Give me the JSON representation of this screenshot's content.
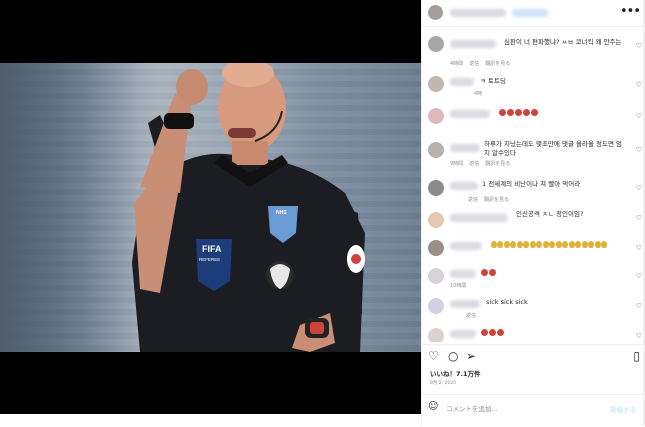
{
  "media": {
    "kit_badges": {
      "fifa": "FIFA",
      "referee": "REFEREE",
      "nhs": "NHS"
    }
  },
  "header": {
    "more_label": "•••"
  },
  "comments": [
    {
      "text": "심판이 너 편파했냐? ㅆㅂ 코너킥 왜 안주는",
      "meta": [
        "4時間",
        "返信",
        "翻訳を見る"
      ]
    },
    {
      "text": "ㅋ 토트딩",
      "meta": [
        "4時"
      ]
    },
    {
      "text": "",
      "badges": [
        "red",
        "red",
        "red",
        "red",
        "red"
      ]
    },
    {
      "text": "하루가 지났는데도 몇초만에 댓글 올라올 정도면 엄\n지 알수있다",
      "meta": [
        "9時間",
        "返信",
        "翻訳を見る"
      ]
    },
    {
      "text": "1 전세계의 비난이나 쳐 빨아 먹어라",
      "meta": [
        "返信",
        "翻訳を見る"
      ]
    },
    {
      "text": "인신공격 ㅈㄴ 정인이임?",
      "meta": []
    },
    {
      "text": "",
      "badges": [
        "gold",
        "gold",
        "gold",
        "gold",
        "gold",
        "gold",
        "gold",
        "gold",
        "gold",
        "gold",
        "gold",
        "gold",
        "gold",
        "gold",
        "gold",
        "gold",
        "gold",
        "gold"
      ]
    },
    {
      "text": "",
      "badges": [
        "red",
        "red"
      ],
      "meta": [
        "10時間"
      ]
    },
    {
      "text": "sick sick sick",
      "meta": [
        "返信"
      ]
    },
    {
      "text": "",
      "badges": [
        "red",
        "red",
        "red"
      ]
    }
  ],
  "actions": {
    "likes": "いいね！7.1万件",
    "date": "8月 2, 2020"
  },
  "add_comment": {
    "placeholder": "コメントを追加...",
    "post_label": "投稿する"
  }
}
